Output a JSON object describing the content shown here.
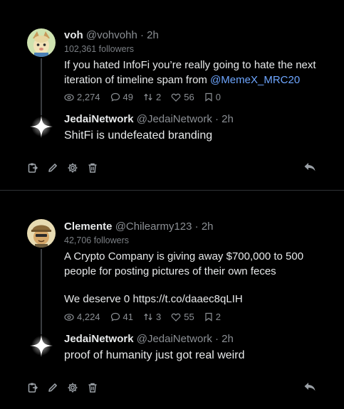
{
  "posts": [
    {
      "author_name": "voh",
      "author_handle": "@vohvohh",
      "time": "2h",
      "followers": "102,361 followers",
      "text_before": "If you hated InfoFi you’re really going to hate the next iteration of timeline spam from ",
      "mention": "@MemeX_MRC20",
      "text_after": "",
      "stats": {
        "views": "2,274",
        "replies": "49",
        "reposts": "2",
        "likes": "56",
        "bookmarks": "0"
      },
      "reply": {
        "author_name": "JedaiNetwork",
        "author_handle": "@JedaiNetwork",
        "time": "2h",
        "text": "ShitFi is undefeated branding"
      }
    },
    {
      "author_name": "Clemente",
      "author_handle": "@Chilearmy123",
      "time": "2h",
      "followers": "42,706 followers",
      "text_line1": "A Crypto Company is giving away $700,000 to 500 people for posting pictures of their own feces",
      "text_line2": "We deserve 0 https://t.co/daaec8qLIH",
      "stats": {
        "views": "4,224",
        "replies": "41",
        "reposts": "3",
        "likes": "55",
        "bookmarks": "2"
      },
      "reply": {
        "author_name": "JedaiNetwork",
        "author_handle": "@JedaiNetwork",
        "time": "2h",
        "text": "proof of humanity just got real weird"
      }
    }
  ],
  "separator": "·",
  "icons": [
    "views-icon",
    "reply-count-icon",
    "repost-icon",
    "like-icon",
    "bookmark-icon",
    "paste-icon",
    "edit-icon",
    "settings-icon",
    "delete-icon",
    "reply-arrow-icon",
    "sparkle-avatar-icon"
  ],
  "colors": {
    "background": "#000000",
    "mention": "#6ea6ff",
    "muted": "#8b8f94"
  }
}
